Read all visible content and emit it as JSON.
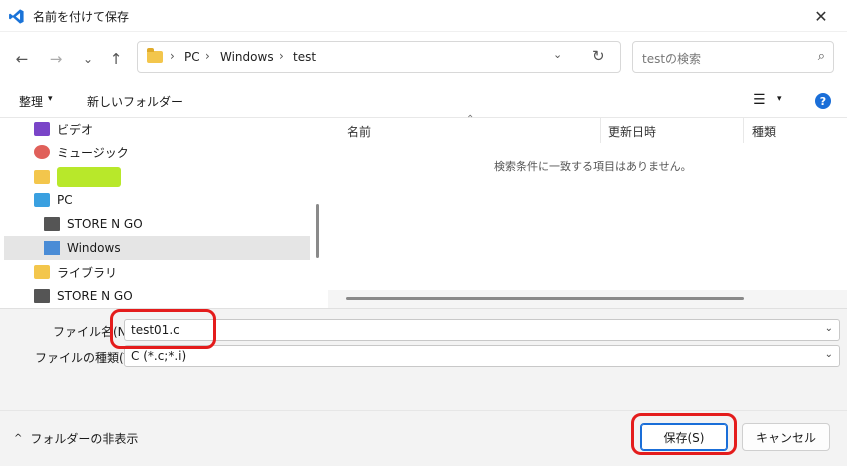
{
  "window": {
    "title": "名前を付けて保存",
    "close_glyph": "✕"
  },
  "nav": {
    "back_glyph": "←",
    "forward_glyph": "→",
    "recent_glyph": "⌄",
    "up_glyph": "↑"
  },
  "address": {
    "crumbs": [
      "PC",
      "Windows",
      "test"
    ],
    "separator": "›",
    "dropdown_glyph": "⌄",
    "refresh_glyph": "↻"
  },
  "search": {
    "placeholder": "testの検索",
    "icon_glyph": "⌕"
  },
  "toolbar": {
    "organize_label": "整理",
    "caret": "▾",
    "new_folder_label": "新しいフォルダー",
    "view_glyph": "☰",
    "help_glyph": "?"
  },
  "sidebar": {
    "items": [
      {
        "label": "ビデオ",
        "icon": "video-icon"
      },
      {
        "label": "ミュージック",
        "icon": "music-icon"
      },
      {
        "label": "",
        "icon": "folder-icon"
      },
      {
        "label": "PC",
        "icon": "pc-icon"
      },
      {
        "label": "STORE N GO",
        "icon": "drive-icon"
      },
      {
        "label": "Windows",
        "icon": "windows-drive-icon"
      },
      {
        "label": "ライブラリ",
        "icon": "folder-icon"
      },
      {
        "label": "STORE N GO",
        "icon": "drive-icon"
      }
    ]
  },
  "file_list": {
    "columns": [
      "名前",
      "更新日時",
      "種類"
    ],
    "sort_glyph": "⌃",
    "empty_message": "検索条件に一致する項目はありません。"
  },
  "form": {
    "filename_label": "ファイル名(N):",
    "filename_value": "test01.c",
    "filetype_label": "ファイルの種類(T):",
    "filetype_value": "C (*.c;*.i)",
    "caret": "⌄"
  },
  "footer": {
    "hide_folders_glyph": "^",
    "hide_folders_label": "フォルダーの非表示",
    "save_label": "保存(S)",
    "cancel_label": "キャンセル"
  },
  "colors": {
    "accent": "#1a6ed8",
    "annotation_red": "#e41c1c",
    "highlight_green": "#b8e82a"
  }
}
